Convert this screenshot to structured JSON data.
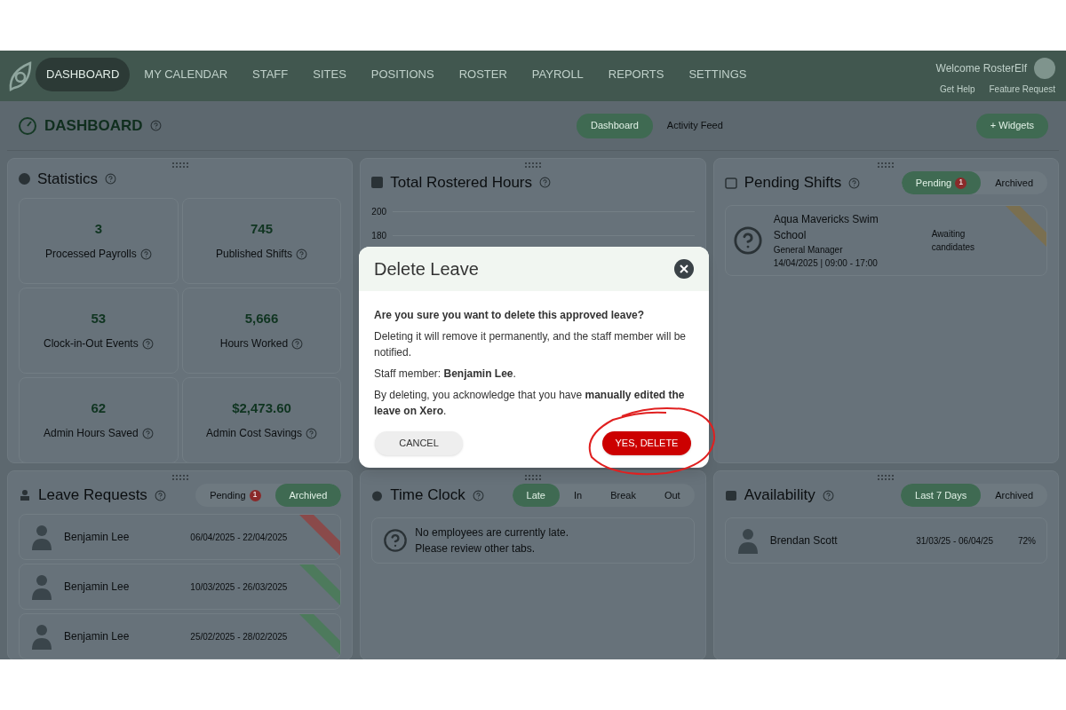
{
  "nav": {
    "items": [
      {
        "label": "DASHBOARD",
        "selected": true
      },
      {
        "label": "MY CALENDAR",
        "selected": false
      },
      {
        "label": "STAFF",
        "selected": false
      },
      {
        "label": "SITES",
        "selected": false
      },
      {
        "label": "POSITIONS",
        "selected": false
      },
      {
        "label": "ROSTER",
        "selected": false
      },
      {
        "label": "PAYROLL",
        "selected": false
      },
      {
        "label": "REPORTS",
        "selected": false
      },
      {
        "label": "SETTINGS",
        "selected": false
      }
    ],
    "welcome": "Welcome RosterElf",
    "help": "Get Help",
    "feature": "Feature Request"
  },
  "header": {
    "title": "DASHBOARD",
    "tabs": [
      {
        "label": "Dashboard",
        "selected": true
      },
      {
        "label": "Activity Feed",
        "selected": false
      }
    ],
    "widgets_button": "+ Widgets"
  },
  "statistics": {
    "title": "Statistics",
    "items": [
      {
        "value": "3",
        "label": "Processed Payrolls"
      },
      {
        "value": "745",
        "label": "Published Shifts"
      },
      {
        "value": "53",
        "label": "Clock-in-Out Events"
      },
      {
        "value": "5,666",
        "label": "Hours Worked"
      },
      {
        "value": "62",
        "label": "Admin Hours Saved"
      },
      {
        "value": "$2,473.60",
        "label": "Admin Cost Savings"
      }
    ]
  },
  "rostered_hours": {
    "title": "Total Rostered Hours",
    "y_ticks": [
      "200",
      "180"
    ]
  },
  "pending_shifts": {
    "title": "Pending Shifts",
    "tabs": [
      {
        "label": "Pending",
        "count": "1",
        "selected": true
      },
      {
        "label": "Archived",
        "selected": false
      }
    ],
    "shifts": [
      {
        "site": "Aqua Mavericks Swim School",
        "position": "General Manager",
        "time": "14/04/2025 | 09:00 - 17:00",
        "status": "Awaiting candidates",
        "color": "#7a6f50"
      }
    ]
  },
  "leave_requests": {
    "title": "Leave Requests",
    "tabs": [
      {
        "label": "Pending",
        "count": "1",
        "selected": false
      },
      {
        "label": "Archived",
        "selected": true
      }
    ],
    "rows": [
      {
        "name": "Benjamin Lee",
        "dates": "06/04/2025 - 22/04/2025",
        "color": "#8a4a4a"
      },
      {
        "name": "Benjamin Lee",
        "dates": "10/03/2025 - 26/03/2025",
        "color": "#4d7a5c"
      },
      {
        "name": "Benjamin Lee",
        "dates": "25/02/2025 - 28/02/2025",
        "color": "#4d7a5c"
      }
    ]
  },
  "time_clock": {
    "title": "Time Clock",
    "tabs": [
      {
        "label": "Late",
        "selected": true
      },
      {
        "label": "In",
        "selected": false
      },
      {
        "label": "Break",
        "selected": false
      },
      {
        "label": "Out",
        "selected": false
      }
    ],
    "empty_lines": [
      "No employees are currently late.",
      "Please review other tabs."
    ]
  },
  "availability": {
    "title": "Availability",
    "tabs": [
      {
        "label": "Last 7 Days",
        "selected": true
      },
      {
        "label": "Archived",
        "selected": false
      }
    ],
    "rows": [
      {
        "name": "Brendan Scott",
        "dates": "31/03/25 - 06/04/25",
        "percent": "72%"
      }
    ]
  },
  "dialog": {
    "title": "Delete Leave",
    "question": "Are you sure you want to delete this approved leave?",
    "lines": [
      "Deleting it will remove it permanently, and the staff member will be notified.",
      "Staff member: **Benjamin Lee**.",
      "By deleting, you acknowledge that you have **manually edited the leave on Xero**."
    ],
    "cancel": "CANCEL",
    "confirm": "YES, DELETE"
  }
}
